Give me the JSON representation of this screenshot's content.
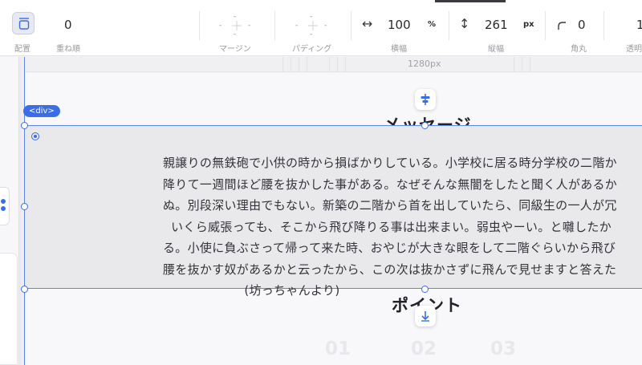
{
  "toolbar": {
    "placement": {
      "label": "配置"
    },
    "z_order": {
      "label": "重ね順",
      "value": "0"
    },
    "margin": {
      "label": "マージン",
      "top": "-",
      "left": "-",
      "right": "-",
      "bottom": "-"
    },
    "padding": {
      "label": "パディング",
      "top": "-",
      "left": "-",
      "right": "-",
      "bottom": "-"
    },
    "width": {
      "label": "横幅",
      "value": "100",
      "unit": "%"
    },
    "height": {
      "label": "縦幅",
      "value": "261",
      "unit": "px"
    },
    "radius": {
      "label": "角丸",
      "value": "0"
    },
    "opacity": {
      "label": "透明",
      "value": "1"
    }
  },
  "ruler": {
    "width_label": "1280px"
  },
  "selection": {
    "tag": "<div>"
  },
  "content": {
    "heading_message": "メッセージ",
    "body_lines": [
      "親譲りの無鉄砲で小供の時から損ばかりしている。小学校に居る時分学校の二階か",
      "降りて一週間ほど腰を抜かした事がある。なぜそんな無闇をしたと聞く人があるか",
      "ぬ。別段深い理由でもない。新築の二階から首を出していたら、同級生の一人が冗",
      "  いくら威張っても、そこから飛び降りる事は出来まい。弱虫やーい。と囃したか",
      "る。小使に負ぶさって帰って来た時、おやじが大きな眼をして二階ぐらいから飛び",
      "腰を抜かす奴があるかと云ったから、この次は抜かさずに飛んで見せますと答えた",
      "                    (坊っちゃんより)"
    ],
    "heading_point": "ポイント",
    "steps": [
      "01",
      "02",
      "03"
    ]
  },
  "colors": {
    "accent": "#3a6de6",
    "selection_bg": "#e9e9eb",
    "canvas_bg": "#f8f8fa"
  }
}
